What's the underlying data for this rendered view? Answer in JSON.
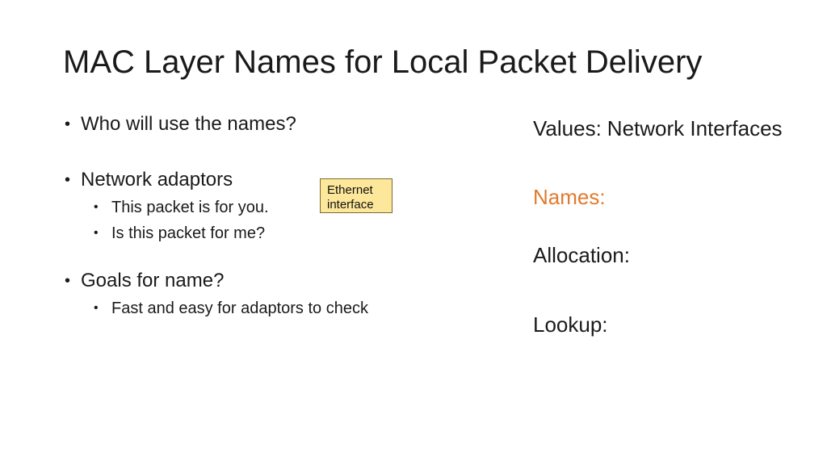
{
  "slide": {
    "title": "MAC Layer Names for Local Packet Delivery"
  },
  "left_column": {
    "bullet_1": "Who will use the names?",
    "bullet_2": "Network adaptors",
    "bullet_2_sub_1": "This packet is for you.",
    "bullet_2_sub_2": "Is this packet for me?",
    "bullet_3": "Goals for name?",
    "bullet_3_sub_1": "Fast and easy for adaptors to check"
  },
  "callout": {
    "line_1": "Ethernet",
    "line_2": "interface",
    "background_color": "#fde79a"
  },
  "right_column": {
    "values_label": "Values:",
    "values_value": "Network Interfaces",
    "names_label": "Names:",
    "names_color": "#e07b2e",
    "allocation_label": "Allocation:",
    "lookup_label": "Lookup:"
  }
}
